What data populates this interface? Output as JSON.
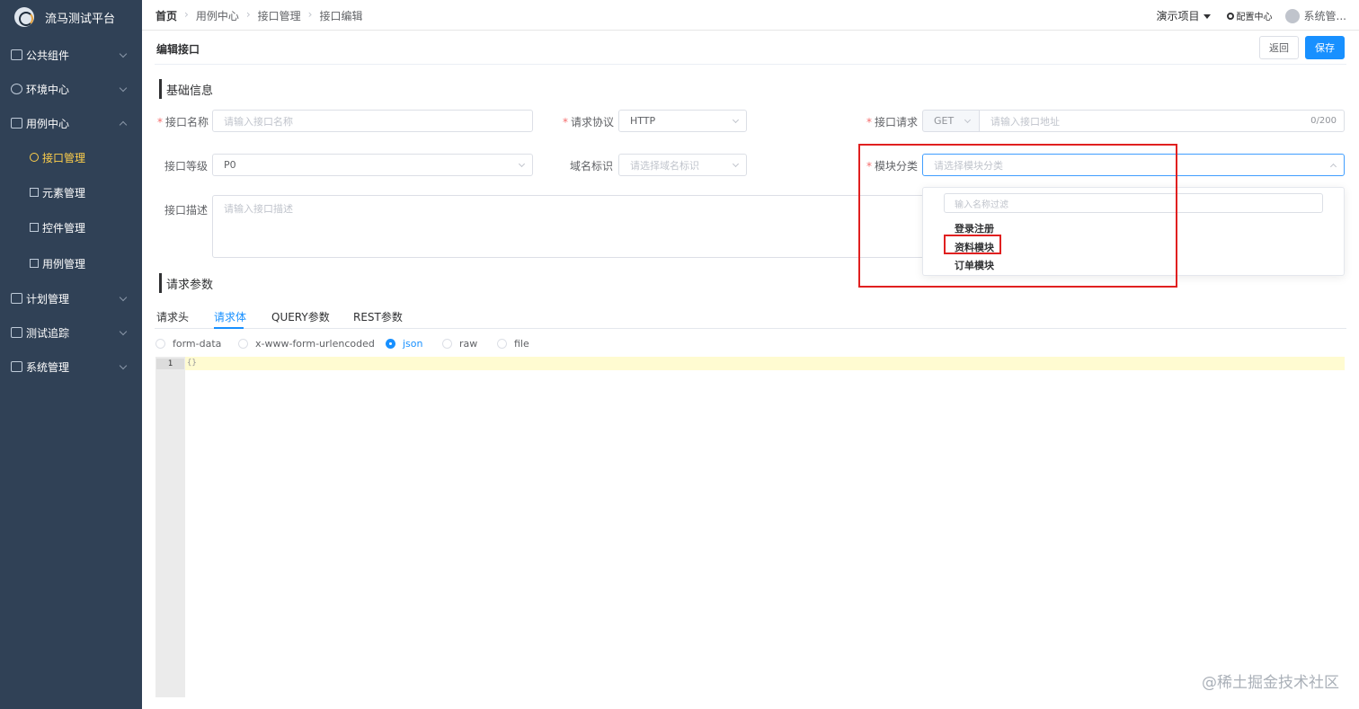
{
  "app": {
    "title": "流马测试平台"
  },
  "sidebar": {
    "items": [
      {
        "label": "公共组件"
      },
      {
        "label": "环境中心"
      },
      {
        "label": "用例中心"
      },
      {
        "label": "计划管理"
      },
      {
        "label": "测试追踪"
      },
      {
        "label": "系统管理"
      }
    ],
    "subitems": [
      {
        "label": "接口管理"
      },
      {
        "label": "元素管理"
      },
      {
        "label": "控件管理"
      },
      {
        "label": "用例管理"
      }
    ]
  },
  "header": {
    "breadcrumb": [
      "首页",
      "用例中心",
      "接口管理",
      "接口编辑"
    ],
    "project": "演示项目",
    "config": "配置中心",
    "user": "系统管..."
  },
  "page": {
    "title": "编辑接口",
    "back_label": "返回",
    "save_label": "保存",
    "section_basic": "基础信息",
    "section_params": "请求参数"
  },
  "form": {
    "name": {
      "label": "接口名称",
      "placeholder": "请输入接口名称"
    },
    "protocol": {
      "label": "请求协议",
      "value": "HTTP"
    },
    "request": {
      "label": "接口请求",
      "method": "GET",
      "placeholder": "请输入接口地址",
      "counter": "0/200"
    },
    "level": {
      "label": "接口等级",
      "value": "P0"
    },
    "domain": {
      "label": "域名标识",
      "placeholder": "请选择域名标识"
    },
    "module": {
      "label": "模块分类",
      "placeholder": "请选择模块分类"
    },
    "desc": {
      "label": "接口描述",
      "placeholder": "请输入接口描述"
    }
  },
  "dropdown": {
    "filter_placeholder": "输入名称过滤",
    "options": [
      "登录注册",
      "资料模块",
      "订单模块"
    ]
  },
  "tabs": [
    "请求头",
    "请求体",
    "QUERY参数",
    "REST参数"
  ],
  "body_types": [
    "form-data",
    "x-www-form-urlencoded",
    "json",
    "raw",
    "file"
  ],
  "editor": {
    "line": "1",
    "code": "{}"
  },
  "watermark": "@稀土掘金技术社区",
  "colors": {
    "sidebar": "#304156",
    "accent": "#1890ff",
    "active_menu": "#ffd04b",
    "highlight_box": "#e02020"
  }
}
